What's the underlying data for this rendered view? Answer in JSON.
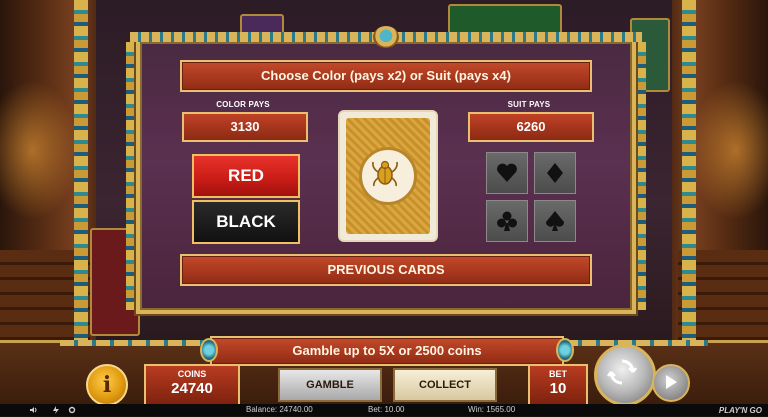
{
  "gamble": {
    "title": "Choose Color (pays x2) or Suit (pays x4)",
    "color_pays_label": "COLOR PAYS",
    "color_pays_value": "3130",
    "suit_pays_label": "SUIT PAYS",
    "suit_pays_value": "6260",
    "red_label": "RED",
    "black_label": "BLACK",
    "previous_cards_label": "PREVIOUS CARDS",
    "suits": [
      "hearts-icon",
      "diamonds-icon",
      "clubs-icon",
      "spades-icon"
    ]
  },
  "bottom": {
    "gamble_info": "Gamble up to 5X or 2500 coins",
    "info_label": "i",
    "coins_label": "COINS",
    "coins_value": "24740",
    "gamble_button": "GAMBLE",
    "collect_button": "COLLECT",
    "bet_label": "BET",
    "bet_value": "10"
  },
  "status": {
    "balance": "Balance: 24740.00",
    "bet": "Bet: 10.00",
    "win": "Win: 1565.00",
    "logo": "PLAY'N GO"
  },
  "colors": {
    "accent_gold": "#d9b45a",
    "bar_red": "#a8381e",
    "red_button": "#c81c16",
    "black_button": "#111111",
    "panel_purple": "#5b3050"
  }
}
